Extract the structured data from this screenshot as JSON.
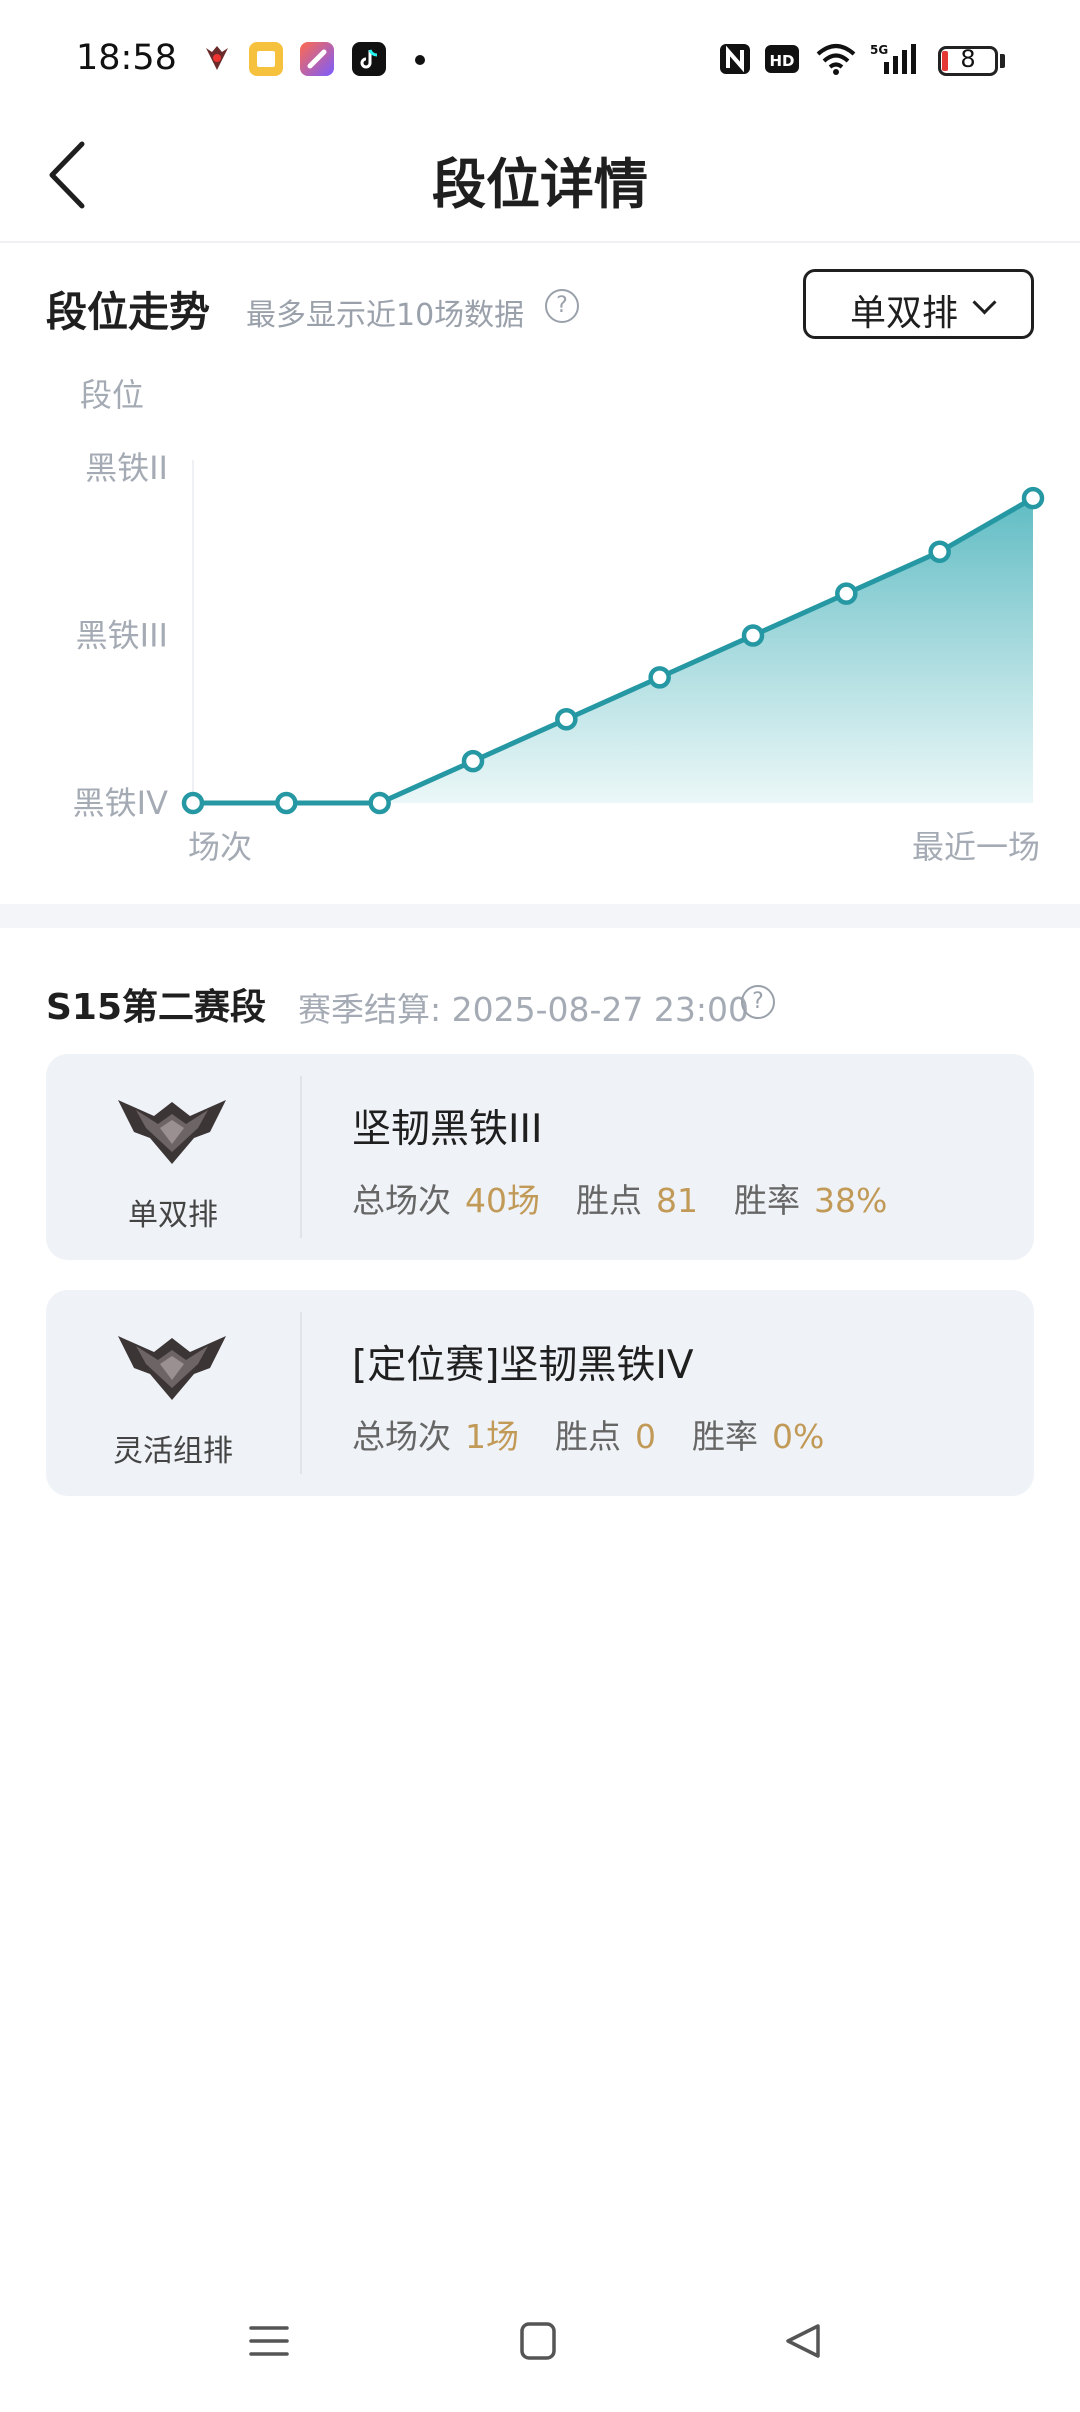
{
  "status_bar": {
    "time": "18:58",
    "battery": "8",
    "app_icons": [
      "game-app-icon",
      "notes-app-icon",
      "tools-app-icon",
      "tiktok-app-icon"
    ],
    "right_icons": [
      "nfc-icon",
      "hd-icon",
      "wifi-icon",
      "signal-5g-icon",
      "battery-icon"
    ]
  },
  "header": {
    "title": "段位详情"
  },
  "trend": {
    "title": "段位走势",
    "subtitle": "最多显示近10场数据",
    "help": "?",
    "queue_select": "单双排"
  },
  "chart_data": {
    "type": "area",
    "ylabel": "段位",
    "xlabel_start": "场次",
    "xlabel_end": "最近一场",
    "y_ticks": [
      "黑铁IV",
      "黑铁III",
      "黑铁II"
    ],
    "ylim": [
      0,
      2
    ],
    "series": [
      {
        "values": [
          0,
          0,
          0,
          0.25,
          0.5,
          0.75,
          1.0,
          1.25,
          1.5,
          1.82
        ]
      }
    ],
    "colors": {
      "line": "#2598a3",
      "fill_top": "#5fbcc3",
      "fill_bottom": "#e9f6f7"
    }
  },
  "season": {
    "title": "S15第二赛段",
    "settle": "赛季结算: 2025-08-27 23:00",
    "help": "?",
    "cards": [
      {
        "queue": "单双排",
        "rank": "坚韧黑铁III",
        "games_label": "总场次",
        "games": "40场",
        "lp_label": "胜点",
        "lp": "81",
        "winrate_label": "胜率",
        "winrate": "38%"
      },
      {
        "queue": "灵活组排",
        "rank": "[定位赛]坚韧黑铁IV",
        "games_label": "总场次",
        "games": "1场",
        "lp_label": "胜点",
        "lp": "0",
        "winrate_label": "胜率",
        "winrate": "0%"
      }
    ]
  },
  "nav_bar": {
    "icons": [
      "menu-icon",
      "home-icon",
      "back-triangle-icon"
    ]
  },
  "colors": {
    "accent_value": "#c29a58",
    "card_bg": "#eff2f6",
    "line": "#2598a3"
  }
}
